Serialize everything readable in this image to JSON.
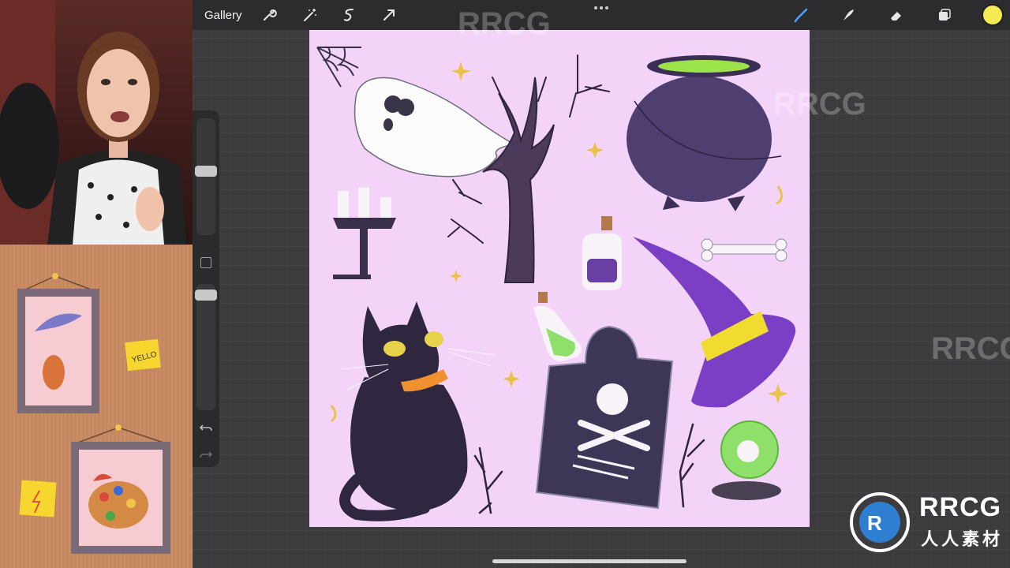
{
  "toolbar": {
    "gallery_label": "Gallery",
    "left_tools": [
      "wrench-icon",
      "magic-wand-icon",
      "selection-icon",
      "transform-arrow-icon"
    ],
    "right_tools": [
      "brush-icon",
      "smudge-icon",
      "eraser-icon",
      "layers-icon"
    ],
    "active_color": "#f4ea54",
    "active_tool_color": "#4aa3ff"
  },
  "sidebar": {
    "brush_size": 0.55,
    "opacity": 0.95
  },
  "room": {
    "sticky_note_text": "YELLO"
  },
  "watermark": {
    "title": "RRCG",
    "subtitle": "人人素材"
  },
  "colors": {
    "canvas_bg": "#f3d4f8",
    "purple_dark": "#4f3f70",
    "witch_hat": "#7a3fc4",
    "hat_band": "#f0dc2e",
    "potion_green": "#8ee06a"
  }
}
